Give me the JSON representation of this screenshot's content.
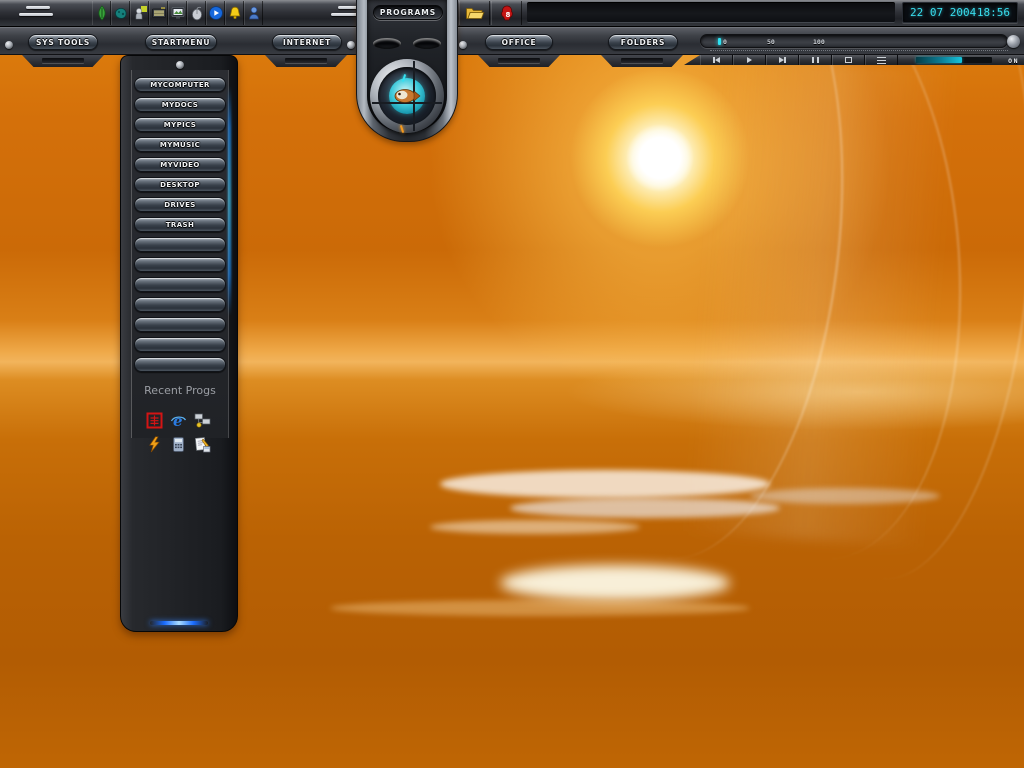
{
  "clock": {
    "date": "22 07 2004",
    "time": "18:56"
  },
  "tabs": {
    "sys_tools": "SYS TOOLS",
    "start_menu": "STARTMENU",
    "internet": "INTERNET",
    "office": "OFFICE",
    "folders": "FOLDERS"
  },
  "pod": {
    "label": "PROGRAMS"
  },
  "ruler": {
    "labels": [
      "0",
      "50",
      "100"
    ]
  },
  "media": {
    "buttons": [
      "previous",
      "play",
      "next",
      "pause",
      "stop",
      "playlist"
    ],
    "power_label": "ON"
  },
  "topbar": {
    "left_icon": "menu-lines",
    "right_icon": "menu-lines",
    "app_icons": [
      "leaf",
      "creature-claw",
      "character",
      "keyboard",
      "monitor",
      "mouse",
      "play-badge",
      "bell",
      "user"
    ],
    "launcher_icons": [
      "open-folder",
      "red-mascot-8"
    ]
  },
  "dock": {
    "items": [
      "MYCOMPUTER",
      "MYDOCS",
      "MYPICS",
      "MYMUSIC",
      "MYVIDEO",
      "DESKTOP",
      "DRIVES",
      "TRASH"
    ],
    "blank_slot_count": 7,
    "recent_label": "Recent Progs",
    "recent_icons": [
      "kanji-app",
      "internet-explorer",
      "network",
      "winamp",
      "calculator",
      "documents"
    ]
  },
  "colors": {
    "accent_cyan": "#38dcec",
    "wallpaper_orange": "#d4700a",
    "led_blue": "#1a6cff",
    "tick_orange": "#f59a1e"
  }
}
